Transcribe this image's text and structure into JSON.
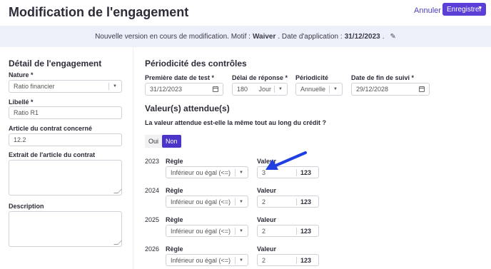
{
  "header": {
    "title": "Modification de l'engagement",
    "cancel_label": "Annuler",
    "save_label": "Enregistrer"
  },
  "banner": {
    "prefix": "Nouvelle version en cours de modification. Motif :",
    "motif": "Waiver",
    "date_label": ". Date d'application :",
    "date": "31/12/2023",
    "suffix": "."
  },
  "left": {
    "title": "Détail de l'engagement",
    "nature_label": "Nature *",
    "nature_value": "Ratio financier",
    "libelle_label": "Libellé *",
    "libelle_value": "Ratio R1",
    "article_label": "Article du contrat concerné",
    "article_value": "12.2",
    "extrait_label": "Extrait de l'article du contrat",
    "description_label": "Description"
  },
  "right": {
    "periodicite_title": "Périodicité des contrôles",
    "first_date_label": "Première date de test *",
    "first_date_value": "31/12/2023",
    "delai_label": "Délai de réponse *",
    "delai_value": "180",
    "delai_unit": "Jour",
    "periodicite_label": "Périodicité",
    "periodicite_value": "Annuelle",
    "end_date_label": "Date de fin de suivi *",
    "end_date_value": "29/12/2028",
    "valeurs_title": "Valeur(s) attendue(s)",
    "question": "La valeur attendue est-elle la même tout au long du crédit ?",
    "oui_label": "Oui",
    "non_label": "Non",
    "regle_label": "Règle",
    "valeur_label": "Valeur",
    "value_unit": "123",
    "rows": [
      {
        "year": "2023",
        "rule": "Inférieur ou égal (<=)",
        "value": "3"
      },
      {
        "year": "2024",
        "rule": "Inférieur ou égal (<=)",
        "value": "2"
      },
      {
        "year": "2025",
        "rule": "Inférieur ou égal (<=)",
        "value": "2"
      },
      {
        "year": "2026",
        "rule": "Inférieur ou égal (<=)",
        "value": "2"
      }
    ]
  },
  "colors": {
    "accent": "#5b3fd6",
    "banner_bg": "#eef0f9",
    "arrow": "#1f3fe0"
  },
  "icons": {
    "edit": "pencil-icon",
    "calendar": "calendar-icon",
    "dropdown": "chevron-down-icon"
  }
}
